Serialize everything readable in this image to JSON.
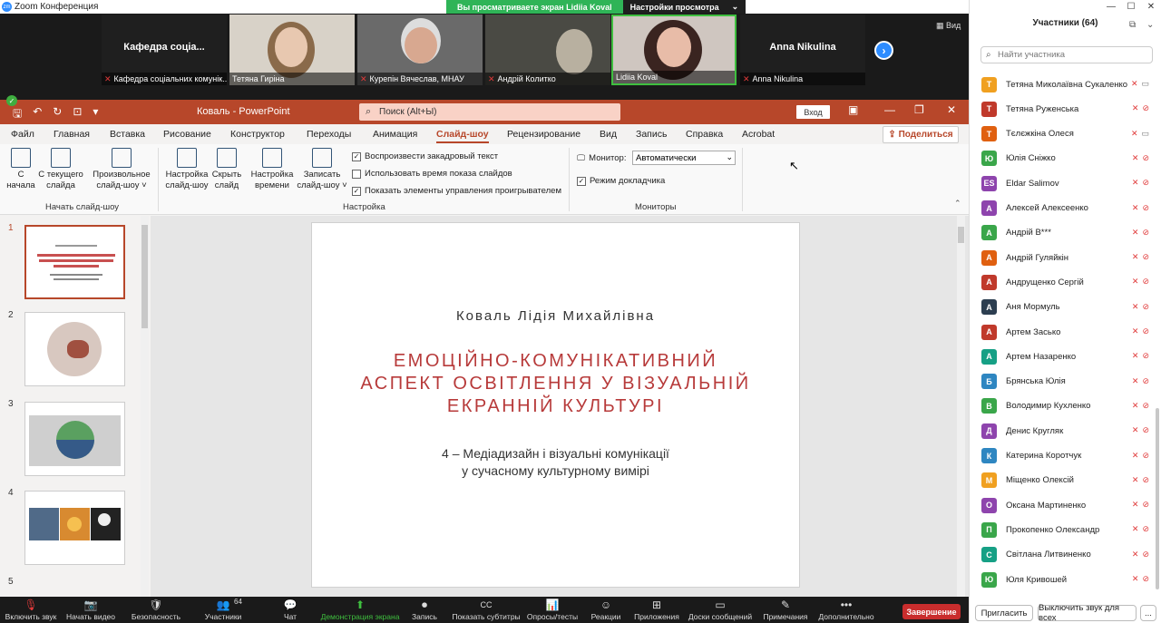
{
  "window": {
    "title": "Zoom Конференция"
  },
  "share_banner": {
    "viewing": "Вы просматриваете экран Lidiia Koval",
    "view_settings": "Настройки просмотра",
    "chevron": "⌄"
  },
  "view_button": "Вид",
  "videos": [
    {
      "name": "Кафедра соціальних комунік...",
      "big": "Кафедра соціа...",
      "muted": true
    },
    {
      "name": "Тетяна Гиріна",
      "muted": false
    },
    {
      "name": "Курепін Вячеслав, МНАУ",
      "muted": true
    },
    {
      "name": "Андрій Колитко",
      "muted": true
    },
    {
      "name": "Lidiia Koval",
      "muted": false
    },
    {
      "name": "Anna Nikulina",
      "big": "Anna Nikulina",
      "muted": true
    }
  ],
  "ppt": {
    "doc_title": "Коваль  -  PowerPoint",
    "search_placeholder": "Поиск (Alt+Ы)",
    "signin": "Вход",
    "share": "Поделиться",
    "tabs": [
      "Файл",
      "Главная",
      "Вставка",
      "Рисование",
      "Конструктор",
      "Переходы",
      "Анимация",
      "Слайд-шоу",
      "Рецензирование",
      "Вид",
      "Запись",
      "Справка",
      "Acrobat"
    ],
    "ribbon": {
      "from_start": [
        "С",
        "начала"
      ],
      "from_current": [
        "С текущего",
        "слайда"
      ],
      "custom_show": [
        "Произвольное",
        "слайд-шоу ˅"
      ],
      "group1": "Начать слайд-шоу",
      "setup_show": [
        "Настройка",
        "слайд-шоу"
      ],
      "hide_slide": [
        "Скрыть",
        "слайд"
      ],
      "rehearse": [
        "Настройка",
        "времени"
      ],
      "record": [
        "Записать",
        "слайд-шоу ˅"
      ],
      "chk_narration": "Воспроизвести закадровый текст",
      "chk_timings": "Использовать время показа слайдов",
      "chk_controls": "Показать элементы управления проигрывателем",
      "group2": "Настройка",
      "monitor_label": "Монитор:",
      "monitor_value": "Автоматически",
      "presenter_view": "Режим докладчика",
      "group3": "Мониторы"
    },
    "thumb_numbers": [
      "1",
      "2",
      "3",
      "4",
      "5"
    ],
    "slide": {
      "author": "Коваль Лідія Михайлівна",
      "title": [
        "ЕМОЦІЙНО-КОМУНІКАТИВНИЙ",
        "АСПЕКТ ОСВІТЛЕННЯ У ВІЗУАЛЬНІЙ",
        "ЕКРАННІЙ КУЛЬТУРІ"
      ],
      "subtitle": [
        "4 – Медіадизайн і візуальні комунікації",
        "у сучасному культурному вимірі"
      ]
    }
  },
  "participants": {
    "header": "Участники (64)",
    "search_placeholder": "Найти участника",
    "list": [
      {
        "initial": "Т",
        "name": "Тетяна Миколаївна Сукаленко",
        "color": "#f0a020",
        "cam": true
      },
      {
        "initial": "Т",
        "name": "Тетяна Руженська",
        "color": "#c0392b",
        "cam": false
      },
      {
        "initial": "Т",
        "name": "Тєлєжкіна Олеся",
        "color": "#e06010",
        "cam": true
      },
      {
        "initial": "Ю",
        "name": "Юлія Сніжко",
        "color": "#3aa64a",
        "cam": false
      },
      {
        "initial": "ES",
        "name": "Eldar Salimov",
        "color": "#8e44ad",
        "cam": false
      },
      {
        "initial": "А",
        "name": "Алексей Алексеенко",
        "color": "#8e44ad",
        "cam": false
      },
      {
        "initial": "А",
        "name": "Андрій В***",
        "color": "#3aa64a",
        "cam": false
      },
      {
        "initial": "А",
        "name": "Андрій Гуляйкін",
        "color": "#e06010",
        "cam": false
      },
      {
        "initial": "А",
        "name": "Андрущенко Сергій",
        "color": "#c0392b",
        "cam": false
      },
      {
        "initial": "А",
        "name": "Аня Мормуль",
        "color": "#2c3e50",
        "cam": false
      },
      {
        "initial": "А",
        "name": "Артем Засько",
        "color": "#c0392b",
        "cam": false
      },
      {
        "initial": "А",
        "name": "Артем Назаренко",
        "color": "#16a085",
        "cam": false
      },
      {
        "initial": "Б",
        "name": "Брянська Юлія",
        "color": "#2e86c1",
        "cam": false
      },
      {
        "initial": "В",
        "name": "Володимир Кухленко",
        "color": "#3aa64a",
        "cam": false
      },
      {
        "initial": "Д",
        "name": "Денис Кругляк",
        "color": "#8e44ad",
        "cam": false
      },
      {
        "initial": "К",
        "name": "Катерина Коротчук",
        "color": "#2e86c1",
        "cam": false
      },
      {
        "initial": "М",
        "name": "Міщенко Олексій",
        "color": "#f0a020",
        "cam": false
      },
      {
        "initial": "О",
        "name": "Оксана Мартиненко",
        "color": "#8e44ad",
        "cam": false
      },
      {
        "initial": "П",
        "name": "Прокопенко Олександр",
        "color": "#3aa64a",
        "cam": false
      },
      {
        "initial": "С",
        "name": "Світлана Литвиненко",
        "color": "#16a085",
        "cam": false
      },
      {
        "initial": "Ю",
        "name": "Юля Кривошей",
        "color": "#3aa64a",
        "cam": false
      }
    ],
    "invite": "Пригласить",
    "mute_all": "Выключить звук для всех",
    "more": "..."
  },
  "toolbar": {
    "items": [
      {
        "label": "Включить звук",
        "icon": "🎙"
      },
      {
        "label": "Начать видео",
        "icon": "📷"
      },
      {
        "label": "Безопасность",
        "icon": "🛡"
      },
      {
        "label": "Участники",
        "icon": "👥"
      },
      {
        "label": "Чат",
        "icon": "💬"
      },
      {
        "label": "Демонстрация экрана",
        "icon": "⬆"
      },
      {
        "label": "Запись",
        "icon": "⏺"
      },
      {
        "label": "Показать субтитры",
        "icon": "CC"
      },
      {
        "label": "Опросы/тесты",
        "icon": "📊"
      },
      {
        "label": "Реакции",
        "icon": "☺"
      },
      {
        "label": "Приложения",
        "icon": "⊞"
      },
      {
        "label": "Доски сообщений",
        "icon": "▭"
      },
      {
        "label": "Примечания",
        "icon": "✎"
      },
      {
        "label": "Дополнительно",
        "icon": "•••"
      }
    ],
    "participants_count": "64",
    "end": "Завершение"
  }
}
